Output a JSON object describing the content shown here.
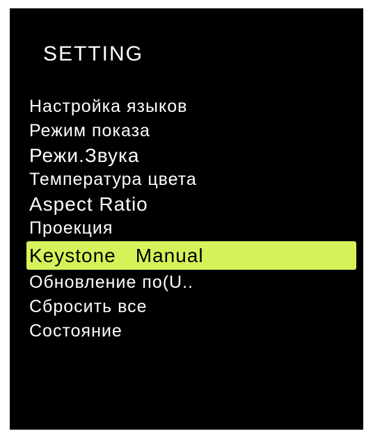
{
  "menu": {
    "title": "SETTING",
    "items": [
      {
        "label": "Настройка языков",
        "value": ""
      },
      {
        "label": "Режим показа",
        "value": ""
      },
      {
        "label": "Режи.Звука",
        "value": ""
      },
      {
        "label": "Температура цвета",
        "value": ""
      },
      {
        "label": "Aspect Ratio",
        "value": ""
      },
      {
        "label": "Проекция",
        "value": ""
      },
      {
        "label": "Keystone",
        "value": "Manual"
      },
      {
        "label": "Обновление по(U..",
        "value": ""
      },
      {
        "label": "Сбросить все",
        "value": ""
      },
      {
        "label": "Состояние",
        "value": ""
      }
    ],
    "selected_index": 6
  },
  "colors": {
    "background": "#000000",
    "text": "#ffffff",
    "highlight": "#d6f25a",
    "highlight_text": "#000000"
  }
}
